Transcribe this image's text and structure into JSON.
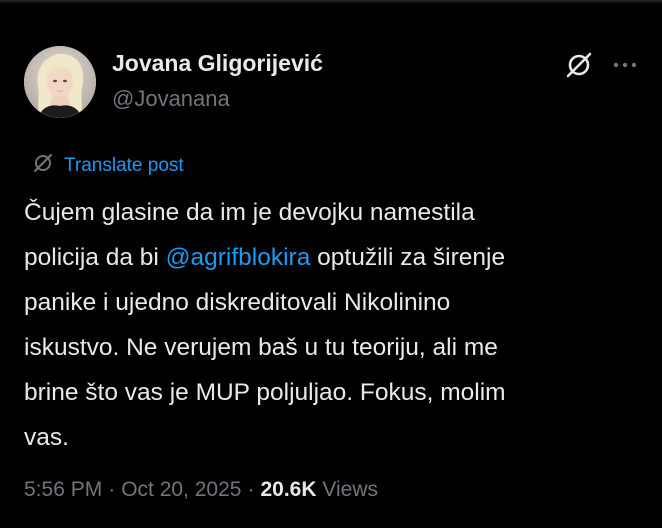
{
  "author": {
    "name": "Jovana Gligorijević",
    "handle": "@Jovanana"
  },
  "icons": {
    "grok": "grok-icon",
    "more": "more-icon",
    "translate": "globe-slash-icon"
  },
  "translate_label": "Translate post",
  "post": {
    "line1": "Čujem glasine da im je devojku namestila",
    "line2_before": "policija da bi ",
    "line2_mention": "@agrifblokira",
    "line2_after": " optužili za širenje",
    "line3": "panike i ujedno diskreditovali Nikolinino",
    "line4": "iskustvo. Ne verujem baš u tu teoriju, ali me",
    "line5": "brine što vas je MUP poljuljao. Fokus, molim",
    "line6": "vas."
  },
  "meta": {
    "time": "5:56 PM",
    "date": "Oct 20, 2025",
    "views_count": "20.6K",
    "views_label": "Views"
  },
  "colors": {
    "background": "#000000",
    "text": "#e7e9ea",
    "secondary": "#71767b",
    "accent": "#1d9bf0"
  }
}
